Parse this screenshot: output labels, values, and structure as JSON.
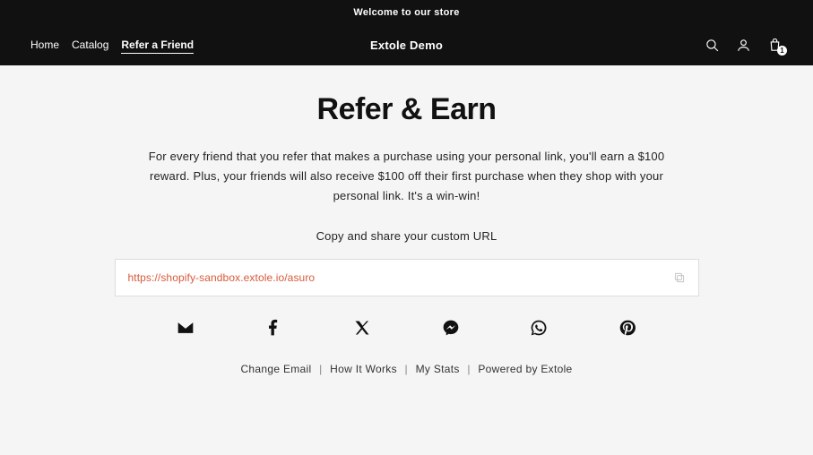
{
  "announce": "Welcome to our store",
  "nav": {
    "home": "Home",
    "catalog": "Catalog",
    "refer": "Refer a Friend"
  },
  "brand": "Extole Demo",
  "cart_count": "1",
  "main": {
    "title": "Refer & Earn",
    "description": "For every friend that you refer that makes a purchase using your personal link, you'll earn a $100 reward. Plus, your friends will also receive $100 off their first purchase when they shop with your personal link. It's a win-win!",
    "url_label": "Copy and share your custom URL",
    "url_value": "https://shopify-sandbox.extole.io/asuro"
  },
  "footer": {
    "change_email": "Change Email",
    "how": "How It Works",
    "stats": "My Stats",
    "powered": "Powered by Extole"
  }
}
